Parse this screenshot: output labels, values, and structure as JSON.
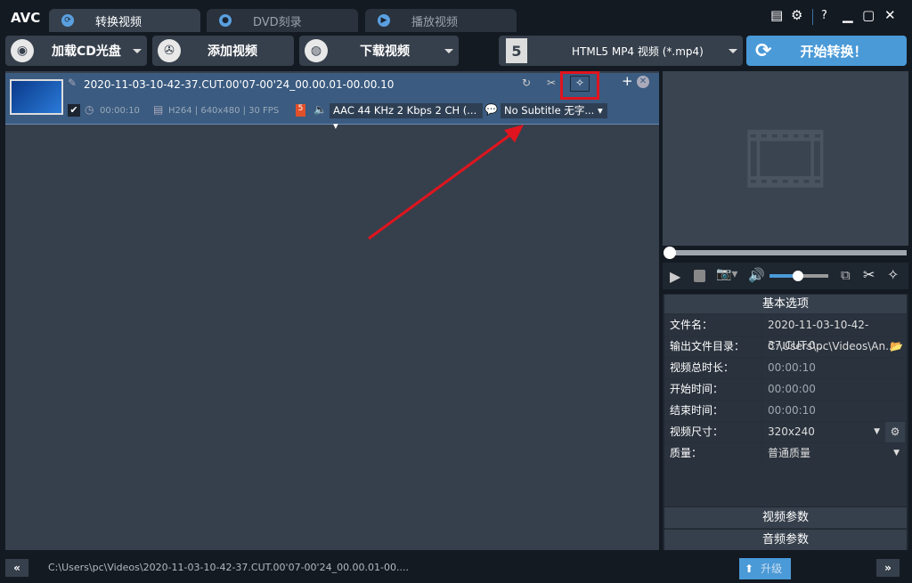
{
  "app": {
    "logo": "AVC"
  },
  "tabs": [
    {
      "label": "转换视频"
    },
    {
      "label": "DVD刻录"
    },
    {
      "label": "播放视频"
    }
  ],
  "window_controls": {
    "help": "?"
  },
  "toolbar": {
    "load_cd": "加载CD光盘",
    "add_video": "添加视频",
    "download_video": "下载视频",
    "format": "HTML5 MP4 视频 (*.mp4)",
    "start": "开始转换！"
  },
  "file_item": {
    "name": "2020-11-03-10-42-37.CUT.00'07-00'24_00.00.01-00.00.10",
    "duration": "00:00:10",
    "video_info": "H264 | 640x480 | 30 FPS",
    "audio": "AAC 44 KHz 2 Kbps 2 CH (...",
    "subtitle": "No Subtitle 无字..."
  },
  "options": {
    "title": "基本选项",
    "rows": [
      {
        "label": "文件名：",
        "value": "2020-11-03-10-42-37.CUT.0..."
      },
      {
        "label": "输出文件目录：",
        "value": "C:\\Users\\pc\\Videos\\An..."
      },
      {
        "label": "视频总时长：",
        "value": "00:00:10"
      },
      {
        "label": "开始时间：",
        "value": "00:00:00"
      },
      {
        "label": "结束时间：",
        "value": "00:00:10"
      },
      {
        "label": "视频尺寸：",
        "value": "320x240"
      },
      {
        "label": "质量：",
        "value": "普通质量"
      }
    ],
    "video_params": "视频参数",
    "audio_params": "音频参数"
  },
  "player": {
    "seek_progress": 0,
    "volume": 0.5
  },
  "status": {
    "path": "C:\\Users\\pc\\Videos\\2020-11-03-10-42-37.CUT.00'07-00'24_00.00.01-00....",
    "upgrade": "升级"
  },
  "colors": {
    "accent": "#4a9ad8",
    "highlight": "#e0141e"
  }
}
